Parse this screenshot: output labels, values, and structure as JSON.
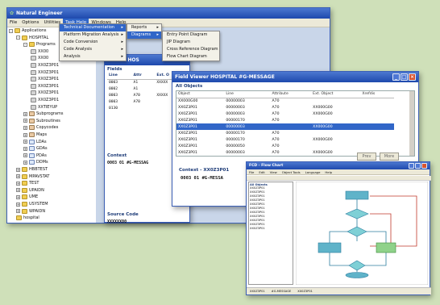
{
  "main_window": {
    "title": "Natural Engineer",
    "menus": [
      "File",
      "Options",
      "Utilities",
      "Task Help",
      "Windows",
      "Help"
    ],
    "active_menu": "Task Help"
  },
  "tree": [
    {
      "label": "Applications",
      "icon": "folder",
      "expander": "-"
    },
    {
      "label": "HOSPITAL",
      "icon": "folder",
      "expander": "-"
    },
    {
      "label": "Programs",
      "icon": "folder",
      "expander": "-"
    },
    {
      "label": "XX00",
      "icon": "doc",
      "expander": ""
    },
    {
      "label": "XX00",
      "icon": "doc",
      "expander": ""
    },
    {
      "label": "XX0Z3P01",
      "icon": "doc",
      "expander": ""
    },
    {
      "label": "XX0Z3P01",
      "icon": "doc",
      "expander": ""
    },
    {
      "label": "XX0Z3P01",
      "icon": "doc",
      "expander": ""
    },
    {
      "label": "XX0Z3P01",
      "icon": "doc",
      "expander": ""
    },
    {
      "label": "XX0Z3P01",
      "icon": "doc",
      "expander": ""
    },
    {
      "label": "XX0Z3P01",
      "icon": "doc",
      "expander": ""
    },
    {
      "label": "XXTIEYUP",
      "icon": "doc",
      "expander": ""
    },
    {
      "label": "Subprograms",
      "icon": "module",
      "expander": "+"
    },
    {
      "label": "Subroutines",
      "icon": "module",
      "expander": "+"
    },
    {
      "label": "Copycodes",
      "icon": "module",
      "expander": "+"
    },
    {
      "label": "Maps",
      "icon": "module",
      "expander": "+"
    },
    {
      "label": "LDAs",
      "icon": "x",
      "expander": "+"
    },
    {
      "label": "GDAs",
      "icon": "x",
      "expander": "+"
    },
    {
      "label": "PDAs",
      "icon": "x",
      "expander": "+"
    },
    {
      "label": "DDMs",
      "icon": "x",
      "expander": "+"
    },
    {
      "label": "HBBTEST",
      "icon": "folder",
      "expander": "+"
    },
    {
      "label": "MPAVSTAT",
      "icon": "folder",
      "expander": "+"
    },
    {
      "label": "TEST",
      "icon": "folder",
      "expander": "+"
    },
    {
      "label": "UPAIDN",
      "icon": "folder",
      "expander": "+"
    },
    {
      "label": "UME",
      "icon": "folder",
      "expander": "+"
    },
    {
      "label": "USYSTEM",
      "icon": "folder",
      "expander": "+"
    },
    {
      "label": "WPAIDN",
      "icon": "folder",
      "expander": "+"
    },
    {
      "label": "hospital",
      "icon": "folder",
      "expander": ""
    }
  ],
  "menu1": [
    {
      "label": "Technical Documentation",
      "submenu": true,
      "selected": true
    },
    {
      "label": "Platform Migration Analysis",
      "submenu": true,
      "selected": false
    },
    {
      "label": "Code Conversion",
      "submenu": true,
      "selected": false
    },
    {
      "label": "Code Analysis",
      "submenu": true,
      "selected": false
    },
    {
      "label": "Analysis",
      "submenu": true,
      "selected": false
    }
  ],
  "menu2": [
    {
      "label": "Reports",
      "submenu": true,
      "selected": false
    },
    {
      "label": "Diagrams",
      "submenu": true,
      "selected": true
    }
  ],
  "menu3": [
    {
      "label": "Entry Point Diagram",
      "selected": false
    },
    {
      "label": "JIP Diagram",
      "selected": false
    },
    {
      "label": "Cross Reference Diagram",
      "selected": false
    },
    {
      "label": "Flow Chart Diagram",
      "selected": false
    }
  ],
  "viewer_win": {
    "title": "Viewer HOS",
    "fields_label": "Fields",
    "headers": [
      "Line",
      "Attr",
      "Ext. O"
    ],
    "rows": [
      [
        "0003",
        "A1",
        "XXXXX"
      ],
      [
        "0002",
        "A1",
        ""
      ],
      [
        "0003",
        "A70",
        "XXXXX"
      ],
      [
        "0003",
        "A70",
        ""
      ],
      [
        "0130",
        "",
        ""
      ]
    ],
    "context_label": "Context",
    "context_text": "0003   01   #G-MESSAG",
    "source_label": "Source Code",
    "source_text": "XXXXXX00"
  },
  "field_viewer": {
    "title": "Field Viewer HOSPITAL #G-MESSAGE",
    "all_objects": "All Objects",
    "headers": [
      "Object",
      "Line",
      "Attribute",
      "Ext. Object",
      "Xrefdis"
    ],
    "rows": [
      [
        "XX000G00",
        "00000003",
        "A70",
        "",
        ""
      ],
      [
        "XX0Z3P01",
        "00000003",
        "A70",
        "XX000G00",
        ""
      ],
      [
        "XX0Z3P01",
        "00000003",
        "A70",
        "XX000G00",
        ""
      ],
      [
        "XX0Z3P01",
        "00000170",
        "A70",
        "",
        ""
      ],
      [
        "XX0Z3P01",
        "00000003",
        "",
        "XX000G00",
        ""
      ],
      [
        "XX0Z3P01",
        "00000170",
        "A70",
        "",
        ""
      ],
      [
        "XX0Z3P01",
        "00000170",
        "A70",
        "XX000G00",
        ""
      ],
      [
        "XX0Z3P01",
        "00000050",
        "A70",
        "",
        ""
      ],
      [
        "XX0Z3P01",
        "00000003",
        "A70",
        "XX000G00",
        ""
      ],
      [
        "XX0Z3P01",
        "00000070",
        "A70",
        "",
        ""
      ]
    ],
    "selected_row": 4,
    "btn_prev": "Prev",
    "btn_more": "More",
    "context_label": "Context - XX0Z3P01",
    "context_text": "0003   01   #G-MESSA"
  },
  "flow_win": {
    "title": "FCD - Flow Chart",
    "menus": [
      "File",
      "Edit",
      "View",
      "Object Tools",
      "Language",
      "Help"
    ],
    "panel_label": "All Objects",
    "list": [
      "XX0Z3P01",
      "XX0Z3P01",
      "XX0Z3P01",
      "XX0Z3P01",
      "XX0Z3P01",
      "XX0Z3P01",
      "XX0Z3P01",
      "XX0Z3P01",
      "XX0Z3P01",
      "XX0Z3P01",
      "XX0Z3P01"
    ],
    "status": [
      "XX0Z3P01",
      "#G-MESSAGE",
      "XX0Z3P01"
    ]
  },
  "colors": {
    "titlebar": "#1e49ad",
    "selection": "#3166c8",
    "flow_box": "#5fb3c9",
    "flow_diamond": "#7fd0d6",
    "flow_green": "#8fd28a",
    "flow_line_red": "#c0392b"
  }
}
